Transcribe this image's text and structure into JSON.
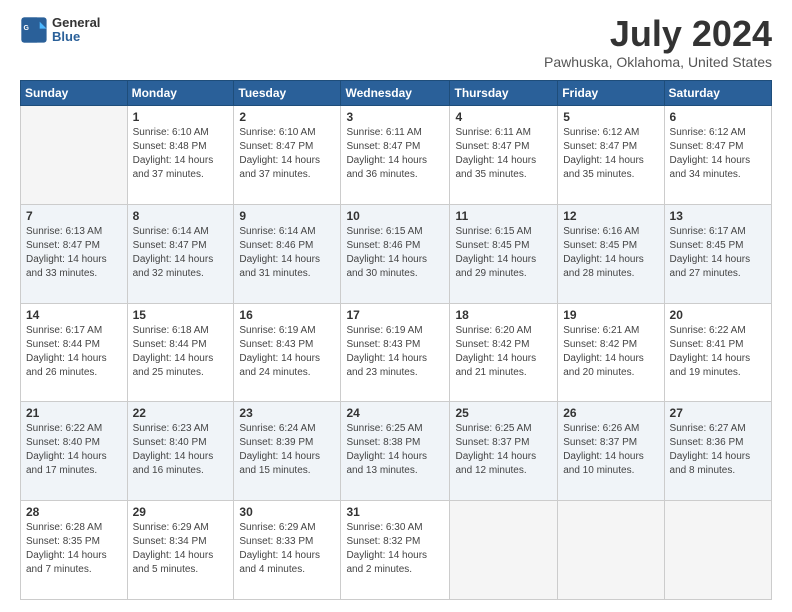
{
  "header": {
    "logo": {
      "line1": "General",
      "line2": "Blue"
    },
    "title": "July 2024",
    "subtitle": "Pawhuska, Oklahoma, United States"
  },
  "calendar": {
    "headers": [
      "Sunday",
      "Monday",
      "Tuesday",
      "Wednesday",
      "Thursday",
      "Friday",
      "Saturday"
    ],
    "weeks": [
      [
        {
          "day": "",
          "empty": true
        },
        {
          "day": "1",
          "sunrise": "6:10 AM",
          "sunset": "8:48 PM",
          "daylight": "14 hours and 37 minutes."
        },
        {
          "day": "2",
          "sunrise": "6:10 AM",
          "sunset": "8:47 PM",
          "daylight": "14 hours and 37 minutes."
        },
        {
          "day": "3",
          "sunrise": "6:11 AM",
          "sunset": "8:47 PM",
          "daylight": "14 hours and 36 minutes."
        },
        {
          "day": "4",
          "sunrise": "6:11 AM",
          "sunset": "8:47 PM",
          "daylight": "14 hours and 35 minutes."
        },
        {
          "day": "5",
          "sunrise": "6:12 AM",
          "sunset": "8:47 PM",
          "daylight": "14 hours and 35 minutes."
        },
        {
          "day": "6",
          "sunrise": "6:12 AM",
          "sunset": "8:47 PM",
          "daylight": "14 hours and 34 minutes."
        }
      ],
      [
        {
          "day": "7",
          "sunrise": "6:13 AM",
          "sunset": "8:47 PM",
          "daylight": "14 hours and 33 minutes."
        },
        {
          "day": "8",
          "sunrise": "6:14 AM",
          "sunset": "8:47 PM",
          "daylight": "14 hours and 32 minutes."
        },
        {
          "day": "9",
          "sunrise": "6:14 AM",
          "sunset": "8:46 PM",
          "daylight": "14 hours and 31 minutes."
        },
        {
          "day": "10",
          "sunrise": "6:15 AM",
          "sunset": "8:46 PM",
          "daylight": "14 hours and 30 minutes."
        },
        {
          "day": "11",
          "sunrise": "6:15 AM",
          "sunset": "8:45 PM",
          "daylight": "14 hours and 29 minutes."
        },
        {
          "day": "12",
          "sunrise": "6:16 AM",
          "sunset": "8:45 PM",
          "daylight": "14 hours and 28 minutes."
        },
        {
          "day": "13",
          "sunrise": "6:17 AM",
          "sunset": "8:45 PM",
          "daylight": "14 hours and 27 minutes."
        }
      ],
      [
        {
          "day": "14",
          "sunrise": "6:17 AM",
          "sunset": "8:44 PM",
          "daylight": "14 hours and 26 minutes."
        },
        {
          "day": "15",
          "sunrise": "6:18 AM",
          "sunset": "8:44 PM",
          "daylight": "14 hours and 25 minutes."
        },
        {
          "day": "16",
          "sunrise": "6:19 AM",
          "sunset": "8:43 PM",
          "daylight": "14 hours and 24 minutes."
        },
        {
          "day": "17",
          "sunrise": "6:19 AM",
          "sunset": "8:43 PM",
          "daylight": "14 hours and 23 minutes."
        },
        {
          "day": "18",
          "sunrise": "6:20 AM",
          "sunset": "8:42 PM",
          "daylight": "14 hours and 21 minutes."
        },
        {
          "day": "19",
          "sunrise": "6:21 AM",
          "sunset": "8:42 PM",
          "daylight": "14 hours and 20 minutes."
        },
        {
          "day": "20",
          "sunrise": "6:22 AM",
          "sunset": "8:41 PM",
          "daylight": "14 hours and 19 minutes."
        }
      ],
      [
        {
          "day": "21",
          "sunrise": "6:22 AM",
          "sunset": "8:40 PM",
          "daylight": "14 hours and 17 minutes."
        },
        {
          "day": "22",
          "sunrise": "6:23 AM",
          "sunset": "8:40 PM",
          "daylight": "14 hours and 16 minutes."
        },
        {
          "day": "23",
          "sunrise": "6:24 AM",
          "sunset": "8:39 PM",
          "daylight": "14 hours and 15 minutes."
        },
        {
          "day": "24",
          "sunrise": "6:25 AM",
          "sunset": "8:38 PM",
          "daylight": "14 hours and 13 minutes."
        },
        {
          "day": "25",
          "sunrise": "6:25 AM",
          "sunset": "8:37 PM",
          "daylight": "14 hours and 12 minutes."
        },
        {
          "day": "26",
          "sunrise": "6:26 AM",
          "sunset": "8:37 PM",
          "daylight": "14 hours and 10 minutes."
        },
        {
          "day": "27",
          "sunrise": "6:27 AM",
          "sunset": "8:36 PM",
          "daylight": "14 hours and 8 minutes."
        }
      ],
      [
        {
          "day": "28",
          "sunrise": "6:28 AM",
          "sunset": "8:35 PM",
          "daylight": "14 hours and 7 minutes."
        },
        {
          "day": "29",
          "sunrise": "6:29 AM",
          "sunset": "8:34 PM",
          "daylight": "14 hours and 5 minutes."
        },
        {
          "day": "30",
          "sunrise": "6:29 AM",
          "sunset": "8:33 PM",
          "daylight": "14 hours and 4 minutes."
        },
        {
          "day": "31",
          "sunrise": "6:30 AM",
          "sunset": "8:32 PM",
          "daylight": "14 hours and 2 minutes."
        },
        {
          "day": "",
          "empty": true
        },
        {
          "day": "",
          "empty": true
        },
        {
          "day": "",
          "empty": true
        }
      ]
    ]
  }
}
